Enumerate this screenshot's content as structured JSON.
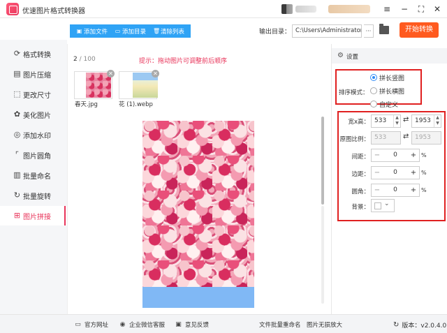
{
  "window": {
    "title": "优速图片格式转换器",
    "min_icon": "minimize-icon",
    "max_icon": "maximize-icon",
    "close_icon": "close-icon",
    "menu_icon": "menu-icon"
  },
  "sidebar": {
    "items": [
      {
        "label": "格式转换",
        "icon": "convert-icon"
      },
      {
        "label": "图片压缩",
        "icon": "compress-icon"
      },
      {
        "label": "更改尺寸",
        "icon": "resize-icon"
      },
      {
        "label": "美化图片",
        "icon": "beautify-icon"
      },
      {
        "label": "添加水印",
        "icon": "watermark-icon"
      },
      {
        "label": "图片圆角",
        "icon": "round-corner-icon"
      },
      {
        "label": "批量命名",
        "icon": "rename-icon"
      },
      {
        "label": "批量旋转",
        "icon": "rotate-icon"
      },
      {
        "label": "图片拼接",
        "icon": "stitch-icon",
        "active": true
      }
    ]
  },
  "toolbar": {
    "add_file": "添加文件",
    "add_folder": "添加目录",
    "clear_list": "清除列表",
    "output_label": "输出目录：",
    "output_path": "C:\\Users\\Administrator\\",
    "more": "···",
    "start": "开始转换"
  },
  "main": {
    "count_current": "2",
    "count_total": " / 100",
    "tip": "提示：拖动图片可调整前后顺序",
    "files": [
      {
        "name": "春天.jpg"
      },
      {
        "name": "花 (1).webp"
      }
    ]
  },
  "settings": {
    "title": "设置",
    "sort_label": "排序模式：",
    "modes": [
      "拼长竖图",
      "拼长横图",
      "自定义"
    ],
    "selected_mode": "拼长竖图",
    "size_label": "宽x高：",
    "width": "533",
    "height": "1953",
    "ratio_label": "原图比例：",
    "ratio_w": "533",
    "ratio_h": "1953",
    "spacing_label": "间距：",
    "spacing": "0",
    "margin_label": "边距：",
    "margin": "0",
    "corner_label": "圆角：",
    "corner": "0",
    "unit": "%",
    "background_label": "背景：",
    "background_color": "#ffffff"
  },
  "footer": {
    "website": "官方网址",
    "wechat": "企业微信客服",
    "feedback": "意见反馈",
    "batch_rename": "文件批量重命名",
    "lossless": "图片无损放大",
    "version": "版本：v2.0.4.0"
  },
  "colors": {
    "accent": "#e8345a",
    "toolbar_blue": "#2fa3f5",
    "start_orange": "#ff5a1f",
    "highlight_red": "#e02020",
    "radio_blue": "#2f8bf5"
  }
}
